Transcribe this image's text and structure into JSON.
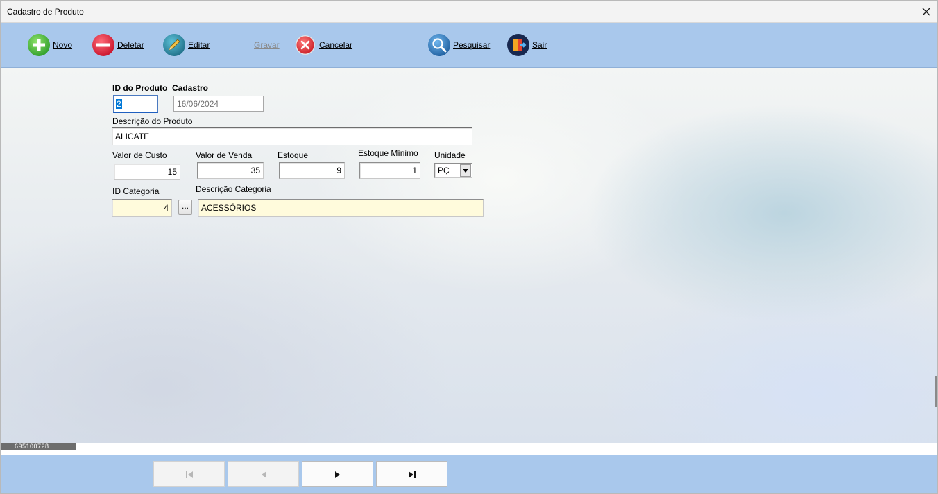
{
  "window": {
    "title": "Cadastro de Produto",
    "close_glyph": "✕"
  },
  "toolbar": {
    "buttons": [
      {
        "label": "Novo",
        "icon": "plus-circle-icon",
        "color": "#3fb837",
        "enabled": true
      },
      {
        "label": "Deletar",
        "icon": "minus-circle-icon",
        "color": "#e12a3a",
        "enabled": true
      },
      {
        "label": "Editar",
        "icon": "pencil-icon",
        "color": "#2f8fa8",
        "enabled": true
      },
      {
        "label": "Gravar",
        "icon": "save-icon",
        "enabled": false
      },
      {
        "label": "Cancelar",
        "icon": "cancel-x-icon",
        "color": "#e0303a",
        "enabled": true
      },
      {
        "label": "Pesquisar",
        "icon": "magnifier-icon",
        "color": "#2d7fc6",
        "enabled": true
      },
      {
        "label": "Sair",
        "icon": "exit-door-icon",
        "color": "#1a2f5c",
        "enabled": true
      }
    ]
  },
  "form": {
    "id_produto": {
      "label": "ID do Produto",
      "value": "2"
    },
    "cadastro": {
      "label": "Cadastro",
      "value": "16/06/2024"
    },
    "descricao": {
      "label": "Descrição do Produto",
      "value": "ALICATE"
    },
    "valor_custo": {
      "label": "Valor de Custo",
      "value": "15"
    },
    "valor_venda": {
      "label": "Valor de Venda",
      "value": "35"
    },
    "estoque": {
      "label": "Estoque",
      "value": "9"
    },
    "estoque_minimo": {
      "label": "Estoque Mínimo",
      "value": "1"
    },
    "unidade": {
      "label": "Unidade",
      "value": "PÇ"
    },
    "id_categoria": {
      "label": "ID Categoria",
      "value": "4"
    },
    "lookup_button": {
      "label": "..."
    },
    "descricao_categoria": {
      "label": "Descrição Categoria",
      "value": "ACESSÓRIOS"
    }
  },
  "status": {
    "code": "695100728"
  },
  "navigator": {
    "buttons": [
      {
        "name": "first",
        "icon": "first-record-icon",
        "enabled": false
      },
      {
        "name": "prior",
        "icon": "prior-record-icon",
        "enabled": false
      },
      {
        "name": "next",
        "icon": "next-record-icon",
        "enabled": true
      },
      {
        "name": "last",
        "icon": "last-record-icon",
        "enabled": true
      }
    ]
  },
  "colors": {
    "toolbar_bg": "#a9c8ec",
    "lookup_field_bg": "#fffbdc",
    "focus_border": "#1f5fc0"
  }
}
